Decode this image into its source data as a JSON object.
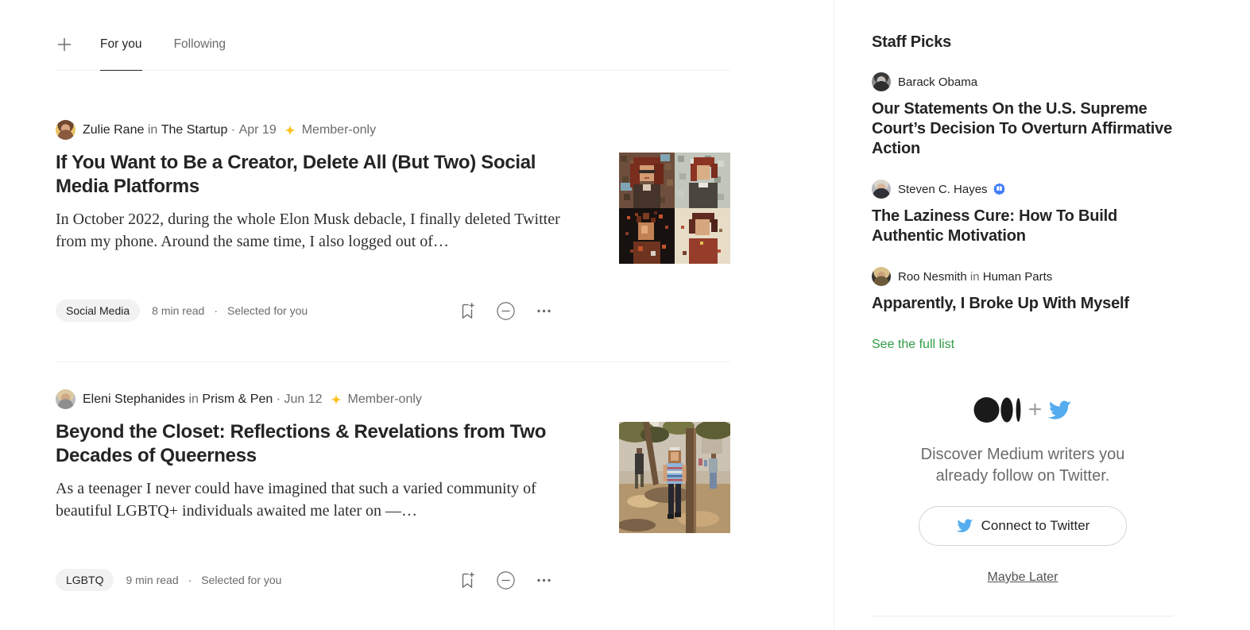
{
  "colors": {
    "accent_green": "#2f9e44",
    "member_gold": "#FFC017",
    "twitter_blue": "#55ACEE",
    "verified_blue": "#3E7BFA",
    "divider": "#F2F2F2",
    "text_primary": "#242424",
    "text_secondary": "#6B6B6B"
  },
  "icons": {
    "add_tab": "plus-icon",
    "separator_dot": "·",
    "logo_plus": "+"
  },
  "tabs": {
    "for_you": "For you",
    "following": "Following"
  },
  "articles": [
    {
      "author": "Zulie Rane",
      "in_label": "in",
      "publication": "The Startup",
      "dot": "·",
      "date": "Apr 19",
      "member_label": "Member-only",
      "title": "If You Want to Be a Creator, Delete All (But Two) Social Media Platforms",
      "excerpt": "In October 2022, during the whole Elon Musk debacle, I finally deleted Twitter from my phone. Around the same time, I also logged out of…",
      "tag": "Social Media",
      "read_time": "8 min read",
      "dot2": "·",
      "selected_label": "Selected for you"
    },
    {
      "author": "Eleni Stephanides",
      "in_label": "in",
      "publication": "Prism & Pen",
      "dot": "·",
      "date": "Jun 12",
      "member_label": "Member-only",
      "title": "Beyond the Closet: Reflections & Revelations from Two Decades of Queerness",
      "excerpt": "As a teenager I never could have imagined that such a varied community of beautiful LGBTQ+ individuals awaited me later on —…",
      "tag": "LGBTQ",
      "read_time": "9 min read",
      "dot2": "·",
      "selected_label": "Selected for you"
    }
  ],
  "staff_picks": {
    "heading": "Staff Picks",
    "items": [
      {
        "author": "Barack Obama",
        "title": "Our Statements On the U.S. Supreme Court’s Decision To Overturn Affirmative Action"
      },
      {
        "author": "Steven C. Hayes",
        "title": "The Laziness Cure: How To Build Authentic Motivation"
      },
      {
        "author": "Roo Nesmith",
        "in_label": "in",
        "publication": "Human Parts",
        "title": "Apparently, I Broke Up With Myself"
      }
    ],
    "see_full_list": "See the full list"
  },
  "twitter_promo": {
    "description_line1": "Discover Medium writers you",
    "description_line2": "already follow on Twitter.",
    "connect_label": "Connect to Twitter",
    "maybe_later_label": "Maybe Later"
  }
}
